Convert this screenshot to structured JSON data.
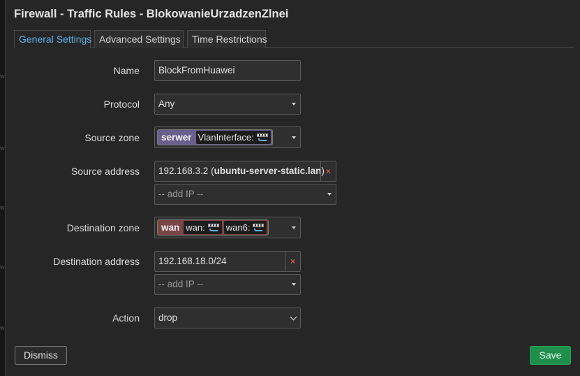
{
  "dialog": {
    "title": "Firewall - Traffic Rules - BlokowanieUrzadzenZlnei"
  },
  "tabs": [
    {
      "label": "General Settings",
      "active": true
    },
    {
      "label": "Advanced Settings",
      "active": false
    },
    {
      "label": "Time Restrictions",
      "active": false
    }
  ],
  "form": {
    "name": {
      "label": "Name",
      "value": "BlockFromHuawei"
    },
    "protocol": {
      "label": "Protocol",
      "value": "Any"
    },
    "source_zone": {
      "label": "Source zone",
      "zone": "serwer",
      "zone_color": "#6a5f8c",
      "interfaces": [
        {
          "label": "VlanInterface:",
          "icon": "network-port-icon"
        }
      ]
    },
    "source_address": {
      "label": "Source address",
      "value_ip": "192.168.3.2 (",
      "value_host": "ubuntu-server-static.lan",
      "value_close": ")",
      "add_placeholder": "-- add IP --"
    },
    "destination_zone": {
      "label": "Destination zone",
      "zone": "wan",
      "zone_color": "#7a4545",
      "interfaces": [
        {
          "label": "wan:",
          "icon": "network-port-icon"
        },
        {
          "label": "wan6:",
          "icon": "network-port-icon"
        }
      ]
    },
    "destination_address": {
      "label": "Destination address",
      "value": "192.168.18.0/24",
      "add_placeholder": "-- add IP --"
    },
    "action": {
      "label": "Action",
      "value": "drop"
    }
  },
  "buttons": {
    "dismiss": "Dismiss",
    "save": "Save"
  },
  "colors": {
    "accent_tab": "#5fb4ea",
    "save_button": "#1e8e4a",
    "remove_x": "#d9534f"
  }
}
